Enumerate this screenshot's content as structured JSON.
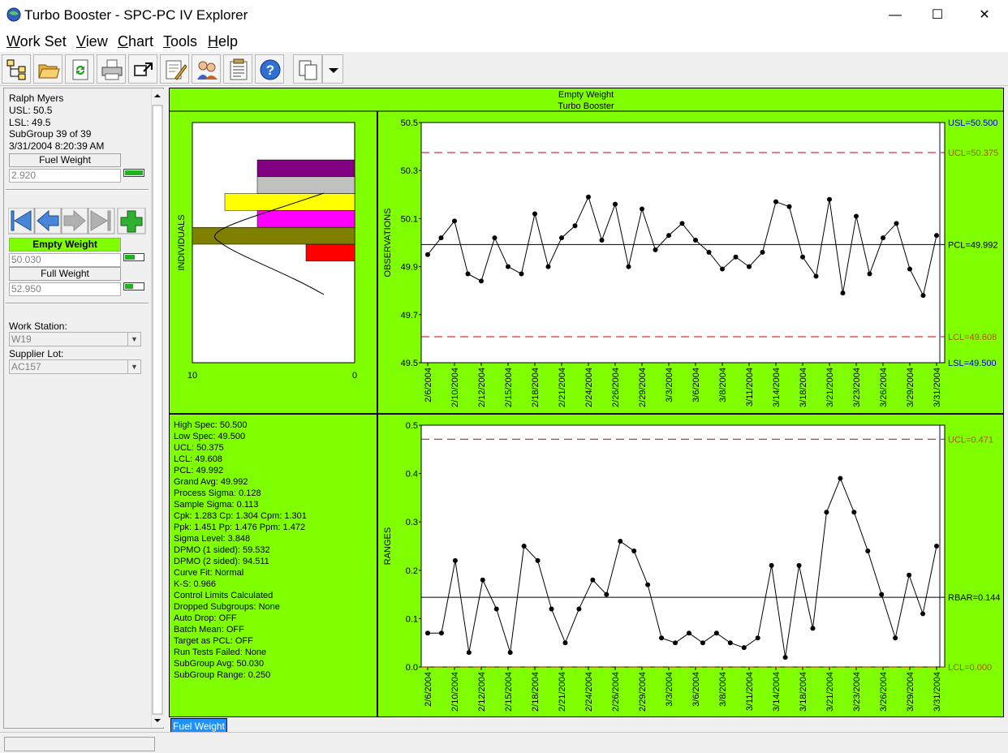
{
  "window": {
    "title": "Turbo Booster - SPC-PC IV Explorer",
    "minimize": "—",
    "maximize": "☐",
    "close": "✕"
  },
  "menu": [
    {
      "key": "W",
      "rest": "ork Set"
    },
    {
      "key": "V",
      "rest": "iew"
    },
    {
      "key": "C",
      "rest": "hart"
    },
    {
      "key": "T",
      "rest": "ools"
    },
    {
      "key": "H",
      "rest": "elp"
    }
  ],
  "toolbar": {
    "icons": [
      "workset-tree-icon",
      "open-folder-icon",
      "refresh-icon",
      "print-icon",
      "export-icon",
      "edit-notes-icon",
      "users-icon",
      "notes-icon",
      "help-icon",
      "copy-icon",
      "dropdown-arrow-icon"
    ]
  },
  "left": {
    "user": "Ralph Myers",
    "usl": "USL:  50.5",
    "lsl": "LSL:  49.5",
    "subgroup": "SubGroup 39 of 39",
    "datetime": "3/31/2004 8:20:39 AM",
    "fuel_weight_button": "Fuel Weight",
    "fuel_weight_value": "2.920",
    "empty_weight_button": "Empty Weight",
    "empty_weight_value": "50.030",
    "full_weight_button": "Full Weight",
    "full_weight_value": "52.950",
    "work_station_label": "Work Station:",
    "work_station_value": "W19",
    "supplier_lot_label": "Supplier Lot:",
    "supplier_lot_value": "AC157"
  },
  "header": {
    "title": "Empty Weight",
    "subtitle": "Turbo Booster"
  },
  "histogram": {
    "ylabel": "INDIVIDUALS",
    "x_left": "10",
    "x_right": "0",
    "colors": [
      "#800080",
      "#c0c0c0",
      "#ffff00",
      "#ff00ff",
      "#808000",
      "#ff0000"
    ],
    "counts": [
      6,
      6,
      8,
      6,
      10,
      3
    ]
  },
  "stats": [
    "High Spec: 50.500",
    "Low Spec: 49.500",
    "UCL: 50.375",
    "LCL: 49.608",
    "PCL: 49.992",
    "Grand Avg: 49.992",
    "Process Sigma: 0.128",
    "Sample Sigma: 0.113",
    "Cpk: 1.283  Cp: 1.304  Cpm: 1.301",
    "Ppk: 1.451  Pp: 1.476  Ppm: 1.472",
    "Sigma Level: 3.848",
    "DPMO (1 sided): 59.532",
    "DPMO (2 sided): 94.511",
    "Curve Fit: Normal",
    "K-S: 0.966",
    "Control Limits Calculated",
    "Dropped Subgroups: None",
    "Auto Drop: OFF",
    "Batch Mean: OFF",
    "Target as PCL: OFF",
    "Run Tests Failed: None",
    "SubGroup Avg: 50.030",
    "SubGroup Range: 0.250"
  ],
  "tab": "Fuel Weight",
  "chart_data": [
    {
      "type": "line",
      "ylabel": "OBSERVATIONS",
      "ylim": [
        49.5,
        50.5
      ],
      "yticks": [
        "50.5",
        "50.3",
        "50.1",
        "49.9",
        "49.7",
        "49.5"
      ],
      "x": [
        "2/6/2004",
        "2/10/2004",
        "2/12/2004",
        "2/15/2004",
        "2/18/2004",
        "2/21/2004",
        "2/24/2004",
        "2/26/2004",
        "2/29/2004",
        "3/3/2004",
        "3/6/2004",
        "3/8/2004",
        "3/11/2004",
        "3/14/2004",
        "3/18/2004",
        "3/21/2004",
        "3/23/2004",
        "3/26/2004",
        "3/29/2004",
        "3/31/2004"
      ],
      "values": [
        49.95,
        50.02,
        50.09,
        49.87,
        49.84,
        50.02,
        49.9,
        49.87,
        50.12,
        49.9,
        50.02,
        50.07,
        50.19,
        50.01,
        50.16,
        49.9,
        50.14,
        49.97,
        50.03,
        50.08,
        50.01,
        49.96,
        49.89,
        49.94,
        49.9,
        49.96,
        50.17,
        50.15,
        49.94,
        49.86,
        50.18,
        49.79,
        50.11,
        49.87,
        50.02,
        50.08,
        49.89,
        49.78,
        50.03
      ],
      "lines": [
        {
          "label": "USL=50.500",
          "value": 50.5,
          "style": "usl"
        },
        {
          "label": "UCL=50.375",
          "value": 50.375,
          "style": "limit"
        },
        {
          "label": "PCL=49.992",
          "value": 49.992,
          "style": "center"
        },
        {
          "label": "LCL=49.608",
          "value": 49.608,
          "style": "limit"
        },
        {
          "label": "LSL=49.500",
          "value": 49.5,
          "style": "usl"
        }
      ]
    },
    {
      "type": "line",
      "ylabel": "RANGES",
      "ylim": [
        0,
        0.5
      ],
      "yticks": [
        "0.5",
        "0.4",
        "0.3",
        "0.2",
        "0.1",
        "0.0"
      ],
      "x": [
        "2/6/2004",
        "2/10/2004",
        "2/12/2004",
        "2/15/2004",
        "2/18/2004",
        "2/21/2004",
        "2/24/2004",
        "2/26/2004",
        "2/29/2004",
        "3/3/2004",
        "3/6/2004",
        "3/8/2004",
        "3/11/2004",
        "3/14/2004",
        "3/18/2004",
        "3/21/2004",
        "3/23/2004",
        "3/26/2004",
        "3/29/2004",
        "3/31/2004"
      ],
      "values": [
        0.07,
        0.07,
        0.22,
        0.03,
        0.18,
        0.12,
        0.03,
        0.25,
        0.22,
        0.12,
        0.05,
        0.12,
        0.18,
        0.15,
        0.26,
        0.24,
        0.17,
        0.06,
        0.05,
        0.07,
        0.05,
        0.07,
        0.05,
        0.04,
        0.06,
        0.21,
        0.02,
        0.21,
        0.08,
        0.32,
        0.39,
        0.32,
        0.24,
        0.15,
        0.06,
        0.19,
        0.11,
        0.25
      ],
      "lines": [
        {
          "label": "UCL=0.471",
          "value": 0.471,
          "style": "limit"
        },
        {
          "label": "RBAR=0.144",
          "value": 0.144,
          "style": "center"
        },
        {
          "label": "LCL=0.000",
          "value": 0.0,
          "style": "limit"
        }
      ]
    }
  ],
  "colors": {
    "chart_bg": "#80ff00",
    "limit": "#cc0000",
    "limit_text": "#b05000",
    "spec_text": "#0000cc",
    "axis_blue": "#000080"
  }
}
